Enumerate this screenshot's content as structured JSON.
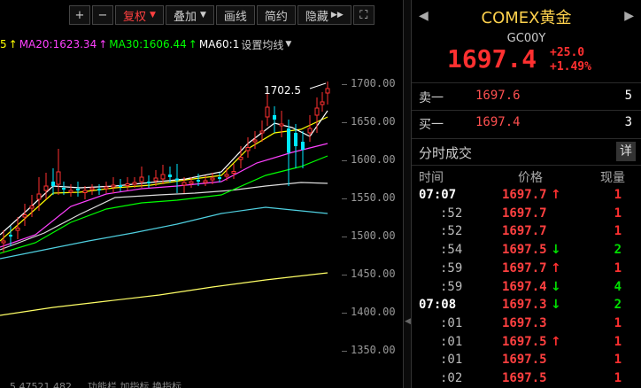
{
  "toolbar": {
    "plus": "+",
    "minus": "−",
    "adjust": "复权",
    "overlay": "叠加",
    "draw": "画线",
    "brief": "简约",
    "hide": "隐藏",
    "expand": "⛶"
  },
  "ma": {
    "ma10_tail": "5",
    "ma20": "MA20:1623.34",
    "ma30": "MA30:1606.44",
    "ma60": "MA60:1",
    "settings": "设置均线",
    "colors": {
      "ma10": "#ffff00",
      "ma20": "#ff40ff",
      "ma30": "#00ff00",
      "ma60": "#ffffff"
    }
  },
  "axis": {
    "labels": [
      "1700.00",
      "1650.00",
      "1600.00",
      "1550.00",
      "1500.00",
      "1450.00",
      "1400.00",
      "1350.00"
    ],
    "values": [
      1700,
      1650,
      1600,
      1550,
      1500,
      1450,
      1400,
      1350
    ]
  },
  "annotation": {
    "high": "1702.5"
  },
  "bottom_text": "…5  47521  482.…              功能栏  加指标  换指标",
  "quote": {
    "title": "COMEX黄金",
    "code": "GC00Y",
    "price": "1697.4",
    "change": "+25.0",
    "change_pct": "+1.49%",
    "up_color": "#ff3030",
    "down_color": "#00e000"
  },
  "book": {
    "sell_label": "卖一",
    "sell_price": "1697.6",
    "sell_qty": "5",
    "buy_label": "买一",
    "buy_price": "1697.4",
    "buy_qty": "3"
  },
  "trades": {
    "title": "分时成交",
    "detail": "详",
    "col_time": "时间",
    "col_price": "价格",
    "col_qty": "现量",
    "rows": [
      {
        "time": "07:07",
        "price": "1697.7",
        "dir": "up",
        "qty": "1"
      },
      {
        "time": ":52",
        "price": "1697.7",
        "dir": "",
        "qty": "1"
      },
      {
        "time": ":52",
        "price": "1697.7",
        "dir": "",
        "qty": "1"
      },
      {
        "time": ":54",
        "price": "1697.5",
        "dir": "down",
        "qty": "2"
      },
      {
        "time": ":59",
        "price": "1697.7",
        "dir": "up",
        "qty": "1"
      },
      {
        "time": ":59",
        "price": "1697.4",
        "dir": "down",
        "qty": "4"
      },
      {
        "time": "07:08",
        "price": "1697.3",
        "dir": "down",
        "qty": "2"
      },
      {
        "time": ":01",
        "price": "1697.3",
        "dir": "",
        "qty": "1"
      },
      {
        "time": ":01",
        "price": "1697.5",
        "dir": "up",
        "qty": "1"
      },
      {
        "time": ":01",
        "price": "1697.5",
        "dir": "",
        "qty": "1"
      },
      {
        "time": ":02",
        "price": "1697.5",
        "dir": "",
        "qty": "1"
      }
    ]
  }
}
